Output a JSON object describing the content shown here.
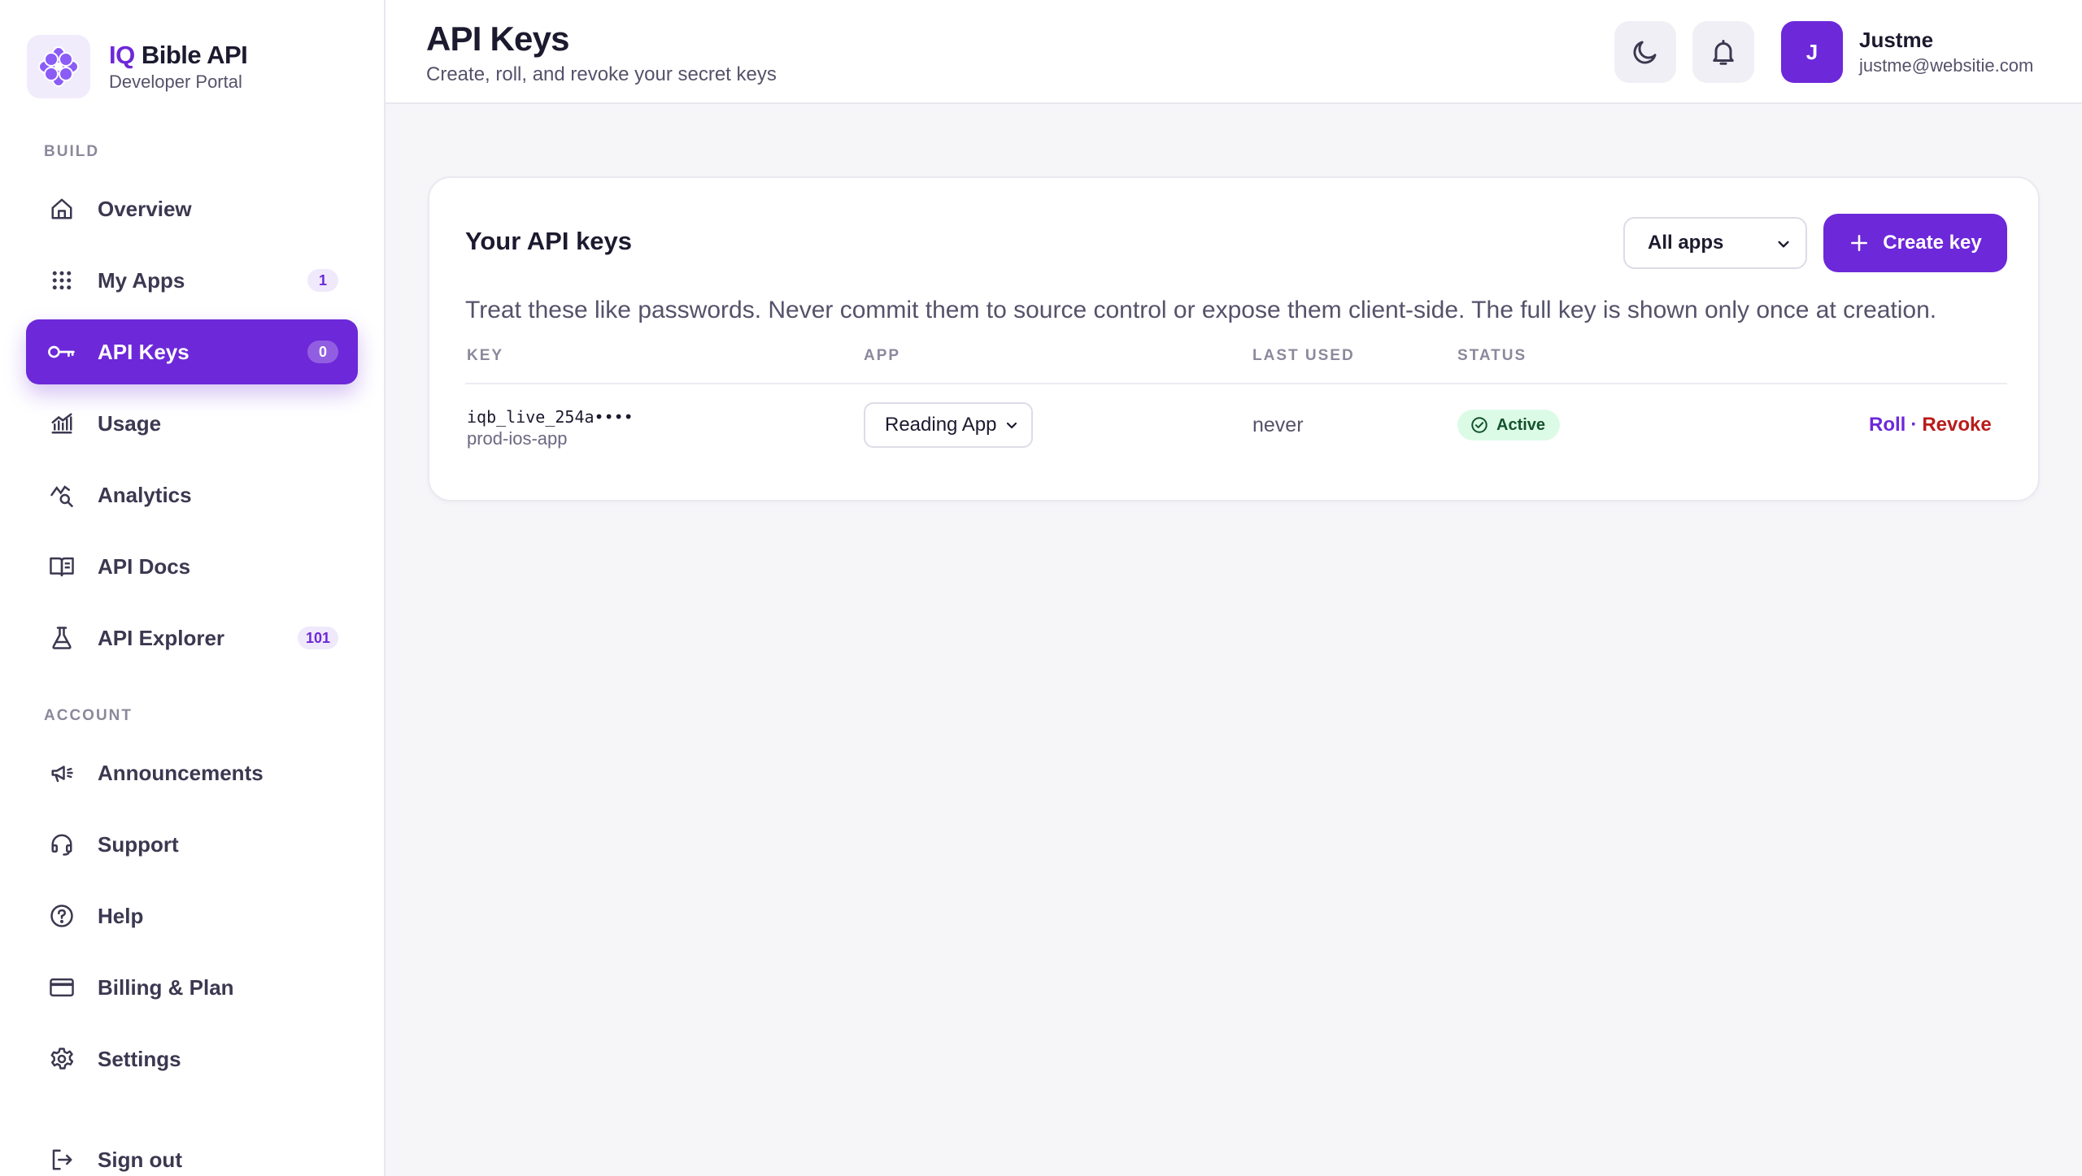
{
  "brand": {
    "title_accent": "IQ",
    "title_rest": " Bible API",
    "subtitle": "Developer Portal",
    "logo_icon": "flower-logo-icon"
  },
  "sidebar": {
    "sections": [
      {
        "label": "BUILD"
      },
      {
        "label": "ACCOUNT"
      }
    ],
    "items": [
      {
        "label": "Overview",
        "icon": "home-icon",
        "badge": ""
      },
      {
        "label": "My Apps",
        "icon": "grid-icon",
        "badge": "1"
      },
      {
        "label": "API Keys",
        "icon": "key-icon",
        "badge": "0",
        "active": true
      },
      {
        "label": "Usage",
        "icon": "bar-chart-icon",
        "badge": ""
      },
      {
        "label": "Analytics",
        "icon": "analytics-search-icon",
        "badge": ""
      },
      {
        "label": "API Docs",
        "icon": "book-icon",
        "badge": ""
      },
      {
        "label": "API Explorer",
        "icon": "flask-icon",
        "badge": "101"
      },
      {
        "label": "Announcements",
        "icon": "megaphone-icon",
        "badge": ""
      },
      {
        "label": "Support",
        "icon": "headset-icon",
        "badge": ""
      },
      {
        "label": "Help",
        "icon": "help-circle-icon",
        "badge": ""
      },
      {
        "label": "Billing & Plan",
        "icon": "credit-card-icon",
        "badge": ""
      },
      {
        "label": "Settings",
        "icon": "gear-icon",
        "badge": ""
      },
      {
        "label": "Sign out",
        "icon": "sign-out-icon",
        "badge": ""
      }
    ]
  },
  "header": {
    "title": "API Keys",
    "subtitle": "Create, roll, and revoke your secret keys",
    "theme_icon": "moon-icon",
    "notif_icon": "bell-icon",
    "user": {
      "initial": "J",
      "name": "Justme",
      "email": "justme@websitie.com"
    }
  },
  "card": {
    "title": "Your API keys",
    "filter": {
      "selected": "All apps"
    },
    "create_label": "Create key",
    "note": "Treat these like passwords. Never commit them to source control or expose them client-side. The full key is shown only once at creation.",
    "columns": [
      "KEY",
      "APP",
      "LAST USED",
      "STATUS"
    ],
    "rows": [
      {
        "key": "iqb_live_254a••••",
        "label": "prod-ios-app",
        "app": "Reading App",
        "last_used": "never",
        "status": "Active",
        "roll": "Roll",
        "sep": "·",
        "revoke": "Revoke"
      }
    ]
  },
  "colors": {
    "accent": "#6d28d9",
    "status_bg": "#dcfbe6",
    "status_fg": "#14532d",
    "danger": "#b91c1c"
  }
}
